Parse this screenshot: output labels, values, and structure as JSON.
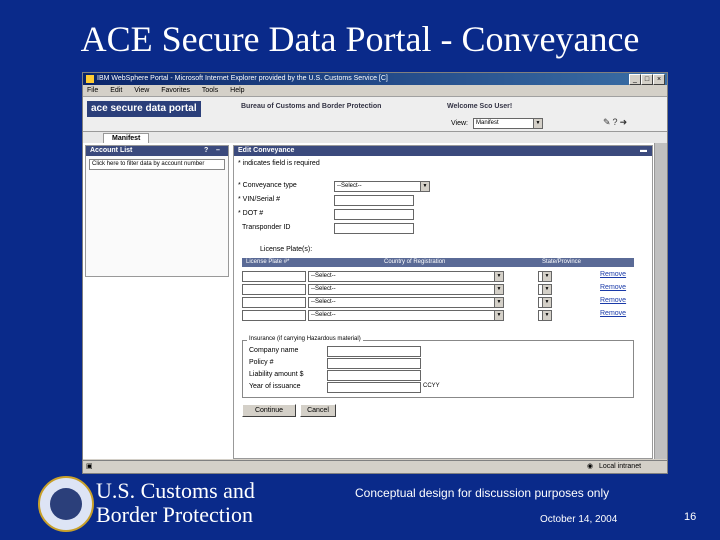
{
  "slide": {
    "title": "ACE Secure Data Portal - Conveyance",
    "org_line1": "U.S. Customs and",
    "org_line2": "Border Protection",
    "disclaimer": "Conceptual design for discussion purposes only",
    "date": "October 14, 2004",
    "page_number": "16"
  },
  "browser": {
    "window_title": "IBM WebSphere Portal - Microsoft Internet Explorer provided by the U.S. Customs Service [C]",
    "menu": [
      "File",
      "Edit",
      "View",
      "Favorites",
      "Tools",
      "Help"
    ],
    "status_text": "Local intranet"
  },
  "portal": {
    "logo_text": "ace secure data portal",
    "bureau": "Bureau of Customs and Border Protection",
    "welcome": "Welcome Sco User!",
    "view_label": "View:",
    "view_value": "Manifest",
    "tab": "Manifest"
  },
  "account_list": {
    "title": "Account List",
    "input_text": "Click here to filter data by account number"
  },
  "edit_conveyance": {
    "title": "Edit Conveyance",
    "required_note": "* indicates field is required",
    "conveyance_type_label": "* Conveyance type",
    "conveyance_type_value": "--Select--",
    "vin_label": "* VIN/Serial #",
    "dot_label": "* DOT #",
    "transponder_label": "Transponder ID",
    "license_plates_label": "License Plate(s):",
    "table_headers": [
      "License Plate #*",
      "Country of Registration",
      "State/Province"
    ],
    "plate_rows": [
      {
        "country": "--Select--",
        "remove": "Remove"
      },
      {
        "country": "--Select--",
        "remove": "Remove"
      },
      {
        "country": "--Select--",
        "remove": "Remove"
      },
      {
        "country": "--Select--",
        "remove": "Remove"
      }
    ],
    "insurance_legend": "Insurance (if carrying Hazardous material)",
    "company_label": "Company name",
    "policy_label": "Policy #",
    "liability_label": "Liability amount $",
    "year_label": "Year of issuance",
    "year_hint": "CCYY",
    "continue_label": "Continue",
    "cancel_label": "Cancel"
  },
  "colors": {
    "slide_background": "#0a2a8a",
    "panel_header": "#3b4a7d",
    "link": "#1a3aa8"
  }
}
